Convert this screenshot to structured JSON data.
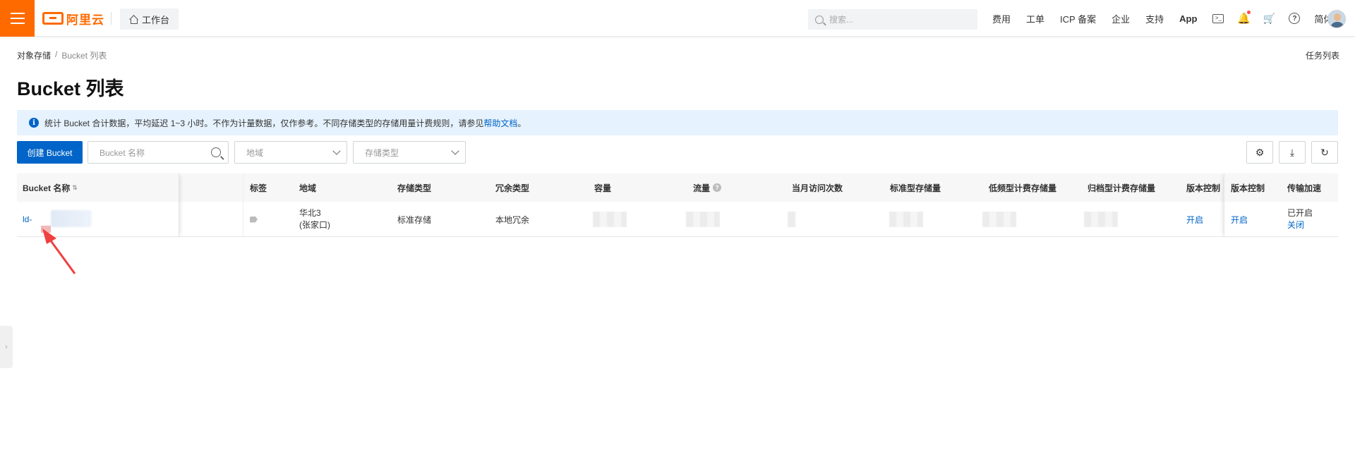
{
  "topbar": {
    "logo_text": "阿里云",
    "workbench_label": "工作台",
    "search_placeholder": "搜索...",
    "nav": [
      "费用",
      "工单",
      "ICP 备案",
      "企业",
      "支持",
      "App"
    ],
    "lang": "简体",
    "brand_color": "#ff6a00"
  },
  "breadcrumb": {
    "root": "对象存储",
    "sep": "/",
    "current": "Bucket 列表"
  },
  "task_list": "任务列表",
  "page_title": "Bucket 列表",
  "banner": {
    "text": "统计 Bucket 合计数据，平均延迟 1~3 小时。不作为计量数据，仅作参考。不同存储类型的存储用量计费规则，请参见",
    "link": "帮助文档",
    "end": "。"
  },
  "toolbar": {
    "create_label": "创建 Bucket",
    "name_placeholder": "Bucket 名称",
    "region_placeholder": "地域",
    "type_placeholder": "存储类型"
  },
  "table": {
    "headers": {
      "name": "Bucket 名称",
      "tags": "标签",
      "region": "地域",
      "storage_type": "存储类型",
      "redundancy": "冗余类型",
      "capacity": "容量",
      "traffic": "流量",
      "visits": "当月访问次数",
      "standard": "标准型存储量",
      "ia": "低频型计费存储量",
      "archive": "归档型计费存储量",
      "versioning": "版本控制",
      "versioning_fixed": "版本控制",
      "acceleration": "传输加速"
    },
    "rows": [
      {
        "name_prefix": "ld-",
        "region_line1": "华北3",
        "region_line2": "(张家口)",
        "storage_type": "标准存储",
        "redundancy": "本地冗余",
        "versioning": "开启",
        "versioning_fixed": "开启",
        "acceleration_status": "已开启",
        "acceleration_action": "关闭"
      }
    ]
  },
  "accent_color": "#0064c8"
}
